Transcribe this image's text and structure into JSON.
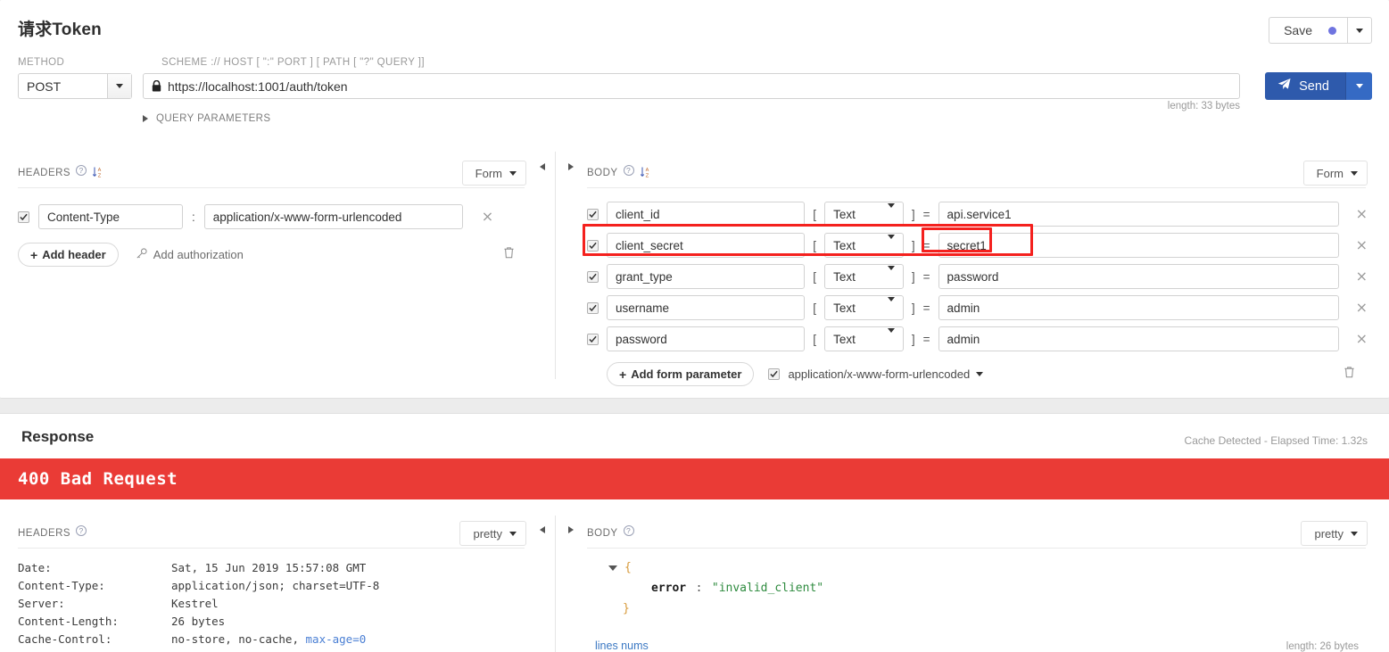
{
  "header": {
    "title": "请求Token",
    "save_label": "Save",
    "save_dot": "modified-indicator",
    "save_caret_icon": "chevron-down-icon"
  },
  "request": {
    "method_label": "METHOD",
    "method_value": "POST",
    "url_label": "SCHEME :// HOST [ \":\" PORT ] [ PATH [ \"?\" QUERY ]]",
    "url_value": "https://localhost:1001/auth/token",
    "lock_icon": "lock-icon",
    "send_label": "Send",
    "send_icon": "paper-plane-icon",
    "length_text": "length: 33 bytes",
    "query_params_label": "QUERY PARAMETERS"
  },
  "headers_panel": {
    "title": "HEADERS",
    "help_icon": "question-circle-icon",
    "sort_icon": "sort-alpha-icon",
    "mode": "Form",
    "collapse_icon": "collapse-left-icon",
    "rows": [
      {
        "enabled": true,
        "name": "Content-Type",
        "sep": ":",
        "value": "application/x-www-form-urlencoded",
        "remove": "×"
      }
    ],
    "add_header_label": "Add header",
    "add_authorization_label": "Add authorization",
    "key_icon": "key-icon",
    "trash_icon": "trash-icon"
  },
  "body_panel": {
    "title": "BODY",
    "help_icon": "question-circle-icon",
    "sort_icon": "sort-alpha-icon",
    "mode": "Form",
    "expand_icon": "expand-right-icon",
    "open_bracket": "[",
    "close_bracket": "]",
    "equals": "=",
    "rows": [
      {
        "enabled": true,
        "name": "client_id",
        "type": "Text",
        "value": "api.service1",
        "remove": "×"
      },
      {
        "enabled": true,
        "name": "client_secret",
        "type": "Text",
        "value": "secret1",
        "remove": "×"
      },
      {
        "enabled": true,
        "name": "grant_type",
        "type": "Text",
        "value": "password",
        "remove": "×"
      },
      {
        "enabled": true,
        "name": "username",
        "type": "Text",
        "value": "admin",
        "remove": "×"
      },
      {
        "enabled": true,
        "name": "password",
        "type": "Text",
        "value": "admin",
        "remove": "×"
      }
    ],
    "add_param_label": "Add form parameter",
    "content_type_enabled": true,
    "content_type": "application/x-www-form-urlencoded",
    "content_type_caret": "chevron-down-icon",
    "trash_icon": "trash-icon"
  },
  "response": {
    "title": "Response",
    "cache_info": "Cache Detected - Elapsed Time: 1.32s",
    "status": "400 Bad Request",
    "status_color": "#ea3b36",
    "headers_panel": {
      "title": "HEADERS",
      "help_icon": "question-circle-icon",
      "mode": "pretty",
      "collapse_icon": "collapse-left-icon",
      "rows": [
        {
          "key": "Date:",
          "value": "Sat, 15 Jun 2019 15:57:08 GMT"
        },
        {
          "key": "Content-Type:",
          "value": "application/json; charset=UTF-8"
        },
        {
          "key": "Server:",
          "value": "Kestrel"
        },
        {
          "key": "Content-Length:",
          "value": "26 bytes"
        },
        {
          "key": "Cache-Control:",
          "value": "no-store, no-cache, ",
          "link": "max-age=0"
        }
      ]
    },
    "body_panel": {
      "title": "BODY",
      "help_icon": "question-circle-icon",
      "mode": "pretty",
      "expand_icon": "expand-right-icon",
      "json_open": "{",
      "json_key": "error",
      "json_colon": ":",
      "json_value": "\"invalid_client\"",
      "json_close": "}",
      "lines_nums_label": "lines nums",
      "length_text": "length: 26 bytes"
    }
  },
  "annotations": {
    "highlight_color": "#f4211e",
    "outer_target": "client_secret-row",
    "inner_target": "client_secret-value"
  }
}
